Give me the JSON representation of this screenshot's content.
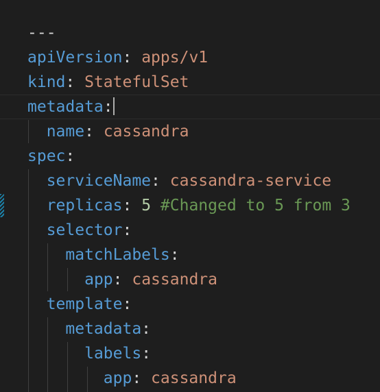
{
  "editor": {
    "language": "yaml",
    "colors": {
      "background": "#1e1e1e",
      "key": "#569cd6",
      "string": "#ce9178",
      "number": "#b5cea8",
      "comment": "#6a9955",
      "punctuation": "#d4d4d4",
      "modified_gutter": "#1b81a8"
    },
    "lines": [
      {
        "doc_start": "---"
      },
      {
        "key": "apiVersion",
        "colon": ":",
        "value": "apps/v1"
      },
      {
        "key": "kind",
        "colon": ":",
        "value": "StatefulSet"
      },
      {
        "key": "metadata",
        "colon": ":"
      },
      {
        "key": "name",
        "colon": ":",
        "value": "cassandra"
      },
      {
        "key": "spec",
        "colon": ":"
      },
      {
        "key": "serviceName",
        "colon": ":",
        "value": "cassandra-service"
      },
      {
        "key": "replicas",
        "colon": ":",
        "value": "5",
        "comment": "#Changed to 5 from 3"
      },
      {
        "key": "selector",
        "colon": ":"
      },
      {
        "key": "matchLabels",
        "colon": ":"
      },
      {
        "key": "app",
        "colon": ":",
        "value": "cassandra"
      },
      {
        "key": "template",
        "colon": ":"
      },
      {
        "key": "metadata",
        "colon": ":"
      },
      {
        "key": "labels",
        "colon": ":"
      },
      {
        "key": "app",
        "colon": ":",
        "value": "cassandra"
      }
    ]
  }
}
